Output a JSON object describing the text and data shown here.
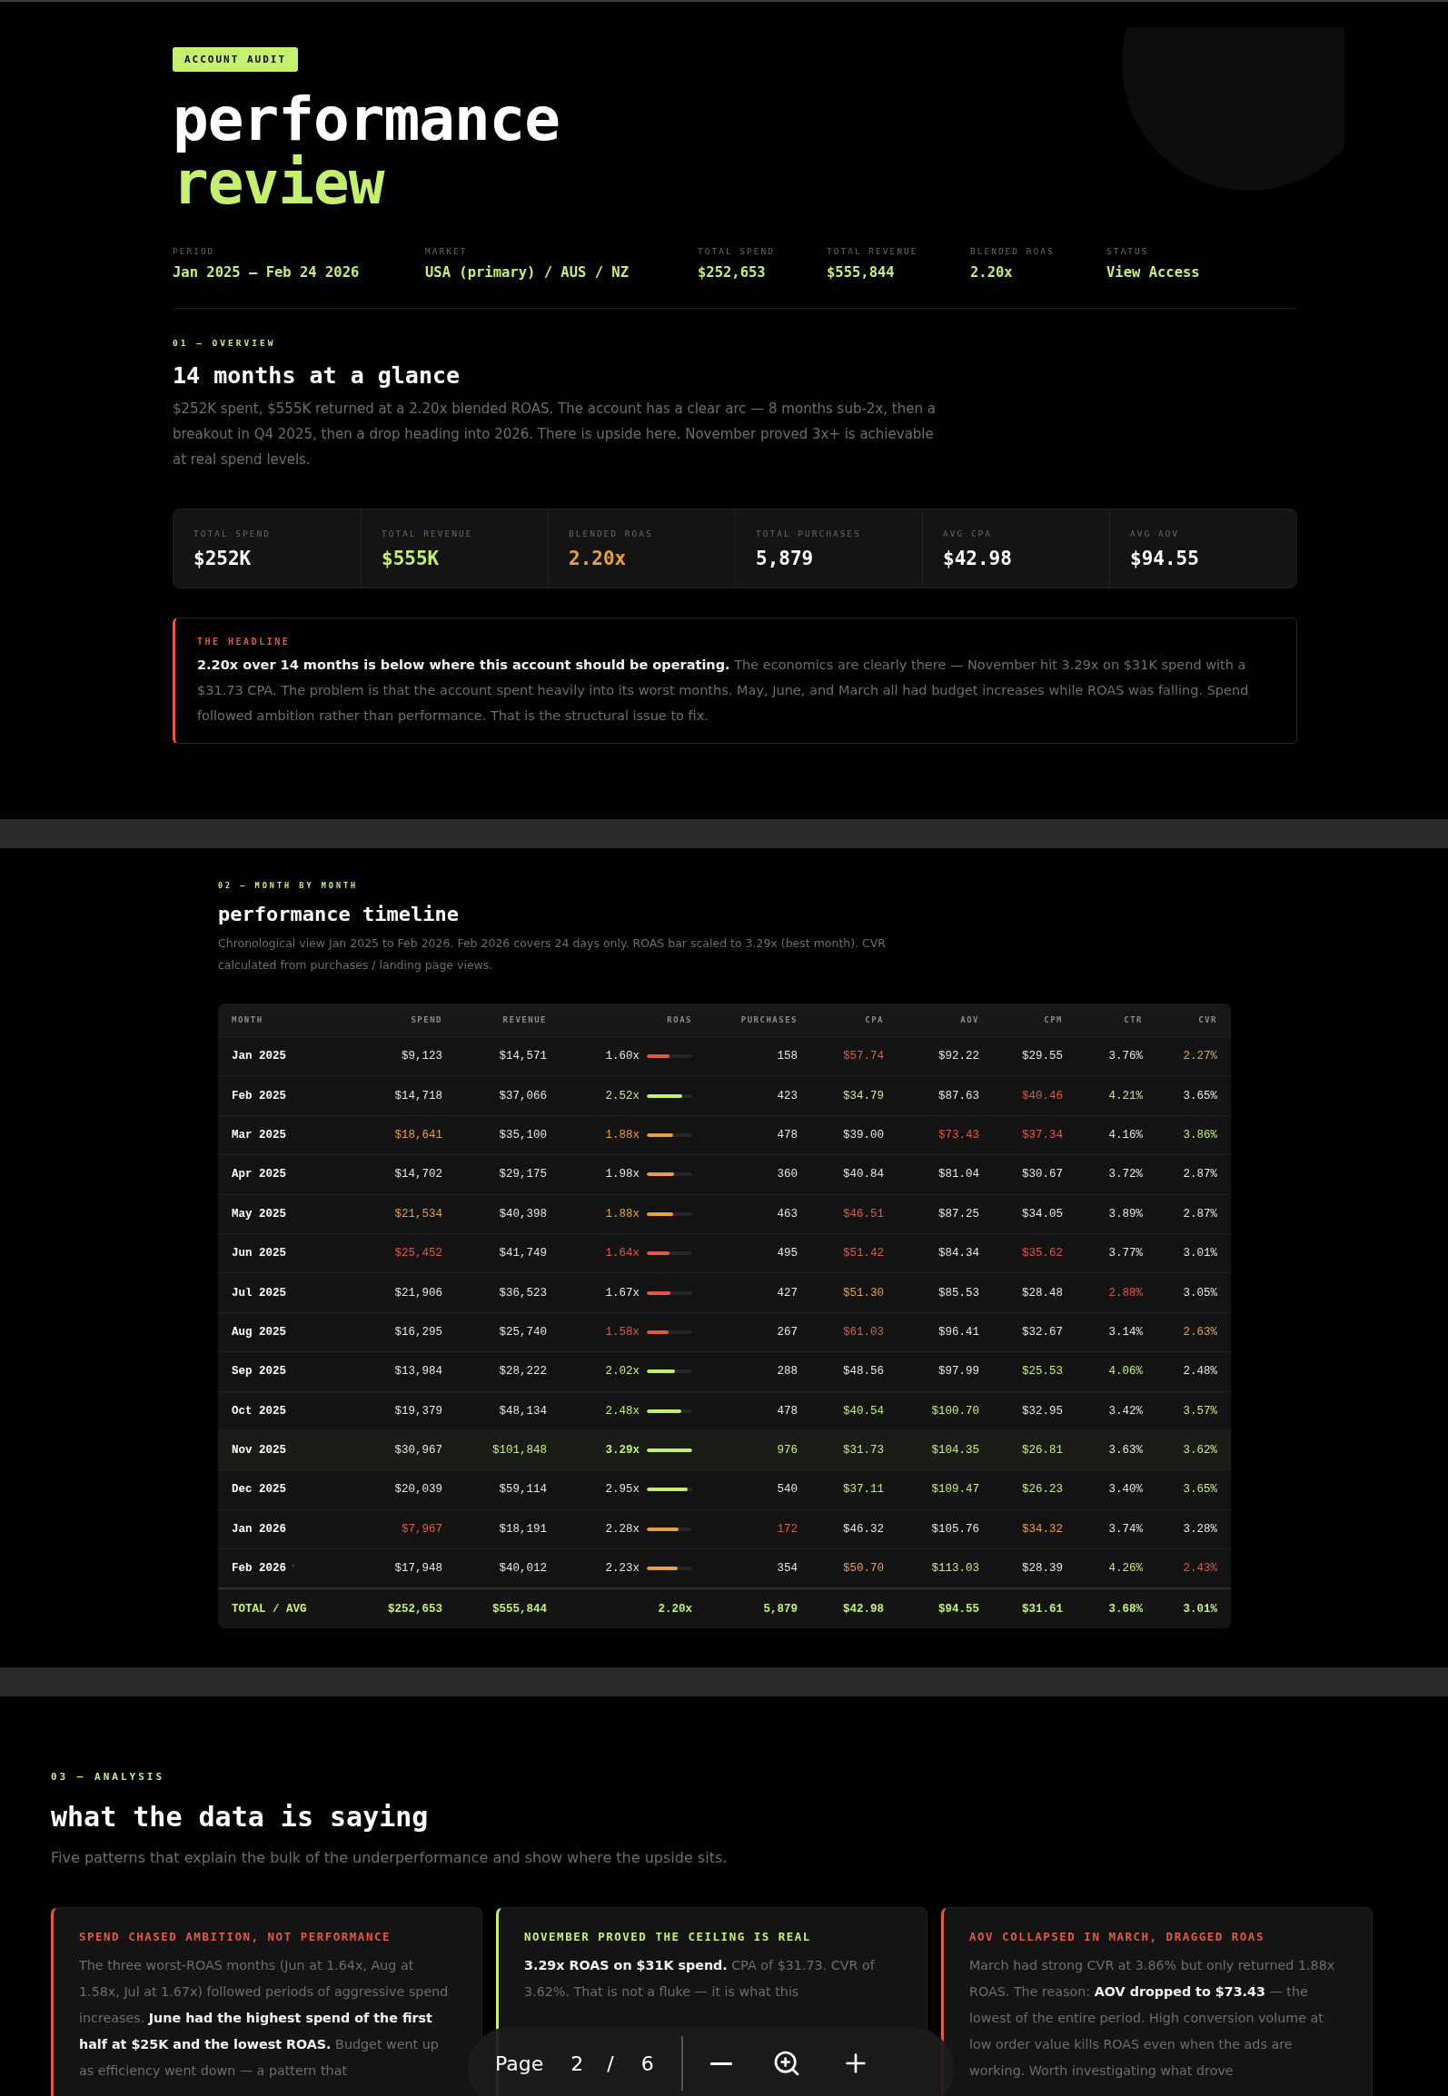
{
  "report": {
    "badge": "ACCOUNT AUDIT",
    "title_line_1": "performance",
    "title_line_2": "review",
    "meta": [
      {
        "label": "PERIOD",
        "value": "Jan 2025 — Feb 24 2026"
      },
      {
        "label": "MARKET",
        "value": "USA (primary) / AUS / NZ"
      },
      {
        "label": "TOTAL SPEND",
        "value": "$252,653"
      },
      {
        "label": "TOTAL REVENUE",
        "value": "$555,844"
      },
      {
        "label": "BLENDED ROAS",
        "value": "2.20x"
      },
      {
        "label": "STATUS",
        "value": "View Access"
      }
    ]
  },
  "overview": {
    "section_label": "01 — OVERVIEW",
    "heading": "14 months at a glance",
    "intro": "$252K spent, $555K returned at a 2.20x blended ROAS. The account has a clear arc — 8 months sub-2x, then a breakout in Q4 2025, then a drop heading into 2026. There is upside here. November proved 3x+ is achievable at real spend levels.",
    "stats": [
      {
        "label": "TOTAL SPEND",
        "value": "$252K",
        "color": "#ffffff"
      },
      {
        "label": "TOTAL REVENUE",
        "value": "$555K",
        "color": "#c5f06f"
      },
      {
        "label": "BLENDED ROAS",
        "value": "2.20x",
        "color": "#e8a043"
      },
      {
        "label": "TOTAL PURCHASES",
        "value": "5,879",
        "color": "#ffffff"
      },
      {
        "label": "AVG CPA",
        "value": "$42.98",
        "color": "#ffffff"
      },
      {
        "label": "AVG AOV",
        "value": "$94.55",
        "color": "#ffffff"
      }
    ],
    "headline": {
      "label": "THE HEADLINE",
      "text": "**2.20x over 14 months is below where this account should be operating.** The economics are clearly there — November hit 3.29x on $31K spend with a $31.73 CPA. The problem is that the account spent heavily into its worst months. May, June, and March all had budget increases while ROAS was falling. Spend followed ambition rather than performance. That is the structural issue to fix."
    }
  },
  "timeline": {
    "section_label": "02 — MONTH BY MONTH",
    "heading": "performance timeline",
    "intro": "Chronological view Jan 2025 to Feb 2026. Feb 2026 covers 24 days only. ROAS bar scaled to 3.29x (best month). CVR calculated from purchases / landing page views.",
    "columns": [
      "MONTH",
      "SPEND",
      "REVENUE",
      "ROAS",
      "PURCHASES",
      "CPA",
      "AOV",
      "CPM",
      "CTR",
      "CVR"
    ],
    "rows": [
      {
        "highlighted": false,
        "cells": [
          {
            "kind": "month",
            "text": "Jan 2025"
          },
          {
            "kind": "text",
            "text": "$9,123",
            "color": "#e6e6e6"
          },
          {
            "kind": "text",
            "text": "$14,571",
            "color": "#e6e6e6"
          },
          {
            "kind": "bar",
            "text": "1.60x",
            "color": "#e6e6e6",
            "bar": {
              "color": "#e05a47",
              "level": 0.49
            }
          },
          {
            "kind": "text",
            "text": "158",
            "color": "#e6e6e6"
          },
          {
            "kind": "text",
            "text": "$57.74",
            "color": "#e05a47"
          },
          {
            "kind": "text",
            "text": "$92.22",
            "color": "#e6e6e6"
          },
          {
            "kind": "text",
            "text": "$29.55",
            "color": "#e6e6e6"
          },
          {
            "kind": "text",
            "text": "3.76%",
            "color": "#e6e6e6"
          },
          {
            "kind": "text",
            "text": "2.27%",
            "color": "#e8a043"
          }
        ]
      },
      {
        "highlighted": false,
        "cells": [
          {
            "kind": "month",
            "text": "Feb 2025"
          },
          {
            "kind": "text",
            "text": "$14,718",
            "color": "#e6e6e6"
          },
          {
            "kind": "text",
            "text": "$37,066",
            "color": "#e6e6e6"
          },
          {
            "kind": "bar",
            "text": "2.52x",
            "color": "#c5f06f",
            "bar": {
              "color": "#c5f06f",
              "level": 0.77
            }
          },
          {
            "kind": "text",
            "text": "423",
            "color": "#e6e6e6"
          },
          {
            "kind": "text",
            "text": "$34.79",
            "color": "#c5f06f"
          },
          {
            "kind": "text",
            "text": "$87.63",
            "color": "#e6e6e6"
          },
          {
            "kind": "text",
            "text": "$40.46",
            "color": "#e05a47"
          },
          {
            "kind": "text",
            "text": "4.21%",
            "color": "#c5f06f"
          },
          {
            "kind": "text",
            "text": "3.65%",
            "color": "#e6e6e6"
          }
        ]
      },
      {
        "highlighted": false,
        "cells": [
          {
            "kind": "month",
            "text": "Mar 2025"
          },
          {
            "kind": "text",
            "text": "$18,641",
            "color": "#e8a043"
          },
          {
            "kind": "text",
            "text": "$35,100",
            "color": "#e6e6e6"
          },
          {
            "kind": "bar",
            "text": "1.88x",
            "color": "#e8a043",
            "bar": {
              "color": "#e8a043",
              "level": 0.57
            }
          },
          {
            "kind": "text",
            "text": "478",
            "color": "#e6e6e6"
          },
          {
            "kind": "text",
            "text": "$39.00",
            "color": "#e6e6e6"
          },
          {
            "kind": "text",
            "text": "$73.43",
            "color": "#e05a47"
          },
          {
            "kind": "text",
            "text": "$37.34",
            "color": "#e05a47"
          },
          {
            "kind": "text",
            "text": "4.16%",
            "color": "#e6e6e6"
          },
          {
            "kind": "text",
            "text": "3.86%",
            "color": "#c5f06f"
          }
        ]
      },
      {
        "highlighted": false,
        "cells": [
          {
            "kind": "month",
            "text": "Apr 2025"
          },
          {
            "kind": "text",
            "text": "$14,702",
            "color": "#e6e6e6"
          },
          {
            "kind": "text",
            "text": "$29,175",
            "color": "#e6e6e6"
          },
          {
            "kind": "bar",
            "text": "1.98x",
            "color": "#e6e6e6",
            "bar": {
              "color": "#e8a043",
              "level": 0.6
            }
          },
          {
            "kind": "text",
            "text": "360",
            "color": "#e6e6e6"
          },
          {
            "kind": "text",
            "text": "$40.84",
            "color": "#e6e6e6"
          },
          {
            "kind": "text",
            "text": "$81.04",
            "color": "#e6e6e6"
          },
          {
            "kind": "text",
            "text": "$30.67",
            "color": "#e6e6e6"
          },
          {
            "kind": "text",
            "text": "3.72%",
            "color": "#e6e6e6"
          },
          {
            "kind": "text",
            "text": "2.87%",
            "color": "#e6e6e6"
          }
        ]
      },
      {
        "highlighted": false,
        "cells": [
          {
            "kind": "month",
            "text": "May 2025"
          },
          {
            "kind": "text",
            "text": "$21,534",
            "color": "#e8a043"
          },
          {
            "kind": "text",
            "text": "$40,398",
            "color": "#e6e6e6"
          },
          {
            "kind": "bar",
            "text": "1.88x",
            "color": "#e8a043",
            "bar": {
              "color": "#e8a043",
              "level": 0.57
            }
          },
          {
            "kind": "text",
            "text": "463",
            "color": "#e6e6e6"
          },
          {
            "kind": "text",
            "text": "$46.51",
            "color": "#e05a47"
          },
          {
            "kind": "text",
            "text": "$87.25",
            "color": "#e6e6e6"
          },
          {
            "kind": "text",
            "text": "$34.05",
            "color": "#e6e6e6"
          },
          {
            "kind": "text",
            "text": "3.89%",
            "color": "#e6e6e6"
          },
          {
            "kind": "text",
            "text": "2.87%",
            "color": "#e6e6e6"
          }
        ]
      },
      {
        "highlighted": false,
        "cells": [
          {
            "kind": "month",
            "text": "Jun 2025"
          },
          {
            "kind": "text",
            "text": "$25,452",
            "color": "#e05a47"
          },
          {
            "kind": "text",
            "text": "$41,749",
            "color": "#e6e6e6"
          },
          {
            "kind": "bar",
            "text": "1.64x",
            "color": "#e05a47",
            "bar": {
              "color": "#e05a47",
              "level": 0.5
            }
          },
          {
            "kind": "text",
            "text": "495",
            "color": "#e6e6e6"
          },
          {
            "kind": "text",
            "text": "$51.42",
            "color": "#e05a47"
          },
          {
            "kind": "text",
            "text": "$84.34",
            "color": "#e6e6e6"
          },
          {
            "kind": "text",
            "text": "$35.62",
            "color": "#e05a47"
          },
          {
            "kind": "text",
            "text": "3.77%",
            "color": "#e6e6e6"
          },
          {
            "kind": "text",
            "text": "3.01%",
            "color": "#e6e6e6"
          }
        ]
      },
      {
        "highlighted": false,
        "cells": [
          {
            "kind": "month",
            "text": "Jul 2025"
          },
          {
            "kind": "text",
            "text": "$21,906",
            "color": "#e6e6e6"
          },
          {
            "kind": "text",
            "text": "$36,523",
            "color": "#e6e6e6"
          },
          {
            "kind": "bar",
            "text": "1.67x",
            "color": "#e6e6e6",
            "bar": {
              "color": "#e05a47",
              "level": 0.51
            }
          },
          {
            "kind": "text",
            "text": "427",
            "color": "#e6e6e6"
          },
          {
            "kind": "text",
            "text": "$51.30",
            "color": "#e8a043"
          },
          {
            "kind": "text",
            "text": "$85.53",
            "color": "#e6e6e6"
          },
          {
            "kind": "text",
            "text": "$28.48",
            "color": "#e6e6e6"
          },
          {
            "kind": "text",
            "text": "2.88%",
            "color": "#e05a47"
          },
          {
            "kind": "text",
            "text": "3.05%",
            "color": "#e6e6e6"
          }
        ]
      },
      {
        "highlighted": false,
        "cells": [
          {
            "kind": "month",
            "text": "Aug 2025"
          },
          {
            "kind": "text",
            "text": "$16,295",
            "color": "#e6e6e6"
          },
          {
            "kind": "text",
            "text": "$25,740",
            "color": "#e6e6e6"
          },
          {
            "kind": "bar",
            "text": "1.58x",
            "color": "#e05a47",
            "bar": {
              "color": "#e05a47",
              "level": 0.48
            }
          },
          {
            "kind": "text",
            "text": "267",
            "color": "#e6e6e6"
          },
          {
            "kind": "text",
            "text": "$61.03",
            "color": "#e05a47"
          },
          {
            "kind": "text",
            "text": "$96.41",
            "color": "#e6e6e6"
          },
          {
            "kind": "text",
            "text": "$32.67",
            "color": "#e6e6e6"
          },
          {
            "kind": "text",
            "text": "3.14%",
            "color": "#e6e6e6"
          },
          {
            "kind": "text",
            "text": "2.63%",
            "color": "#e8a043"
          }
        ]
      },
      {
        "highlighted": false,
        "cells": [
          {
            "kind": "month",
            "text": "Sep 2025"
          },
          {
            "kind": "text",
            "text": "$13,984",
            "color": "#e6e6e6"
          },
          {
            "kind": "text",
            "text": "$28,222",
            "color": "#e6e6e6"
          },
          {
            "kind": "bar",
            "text": "2.02x",
            "color": "#c5f06f",
            "bar": {
              "color": "#c5f06f",
              "level": 0.61
            }
          },
          {
            "kind": "text",
            "text": "288",
            "color": "#e6e6e6"
          },
          {
            "kind": "text",
            "text": "$48.56",
            "color": "#e6e6e6"
          },
          {
            "kind": "text",
            "text": "$97.99",
            "color": "#e6e6e6"
          },
          {
            "kind": "text",
            "text": "$25.53",
            "color": "#c5f06f"
          },
          {
            "kind": "text",
            "text": "4.06%",
            "color": "#c5f06f"
          },
          {
            "kind": "text",
            "text": "2.48%",
            "color": "#e6e6e6"
          }
        ]
      },
      {
        "highlighted": false,
        "cells": [
          {
            "kind": "month",
            "text": "Oct 2025"
          },
          {
            "kind": "text",
            "text": "$19,379",
            "color": "#e6e6e6"
          },
          {
            "kind": "text",
            "text": "$48,134",
            "color": "#e6e6e6"
          },
          {
            "kind": "bar",
            "text": "2.48x",
            "color": "#c5f06f",
            "bar": {
              "color": "#c5f06f",
              "level": 0.75
            }
          },
          {
            "kind": "text",
            "text": "478",
            "color": "#e6e6e6"
          },
          {
            "kind": "text",
            "text": "$40.54",
            "color": "#c5f06f"
          },
          {
            "kind": "text",
            "text": "$100.70",
            "color": "#c5f06f"
          },
          {
            "kind": "text",
            "text": "$32.95",
            "color": "#e6e6e6"
          },
          {
            "kind": "text",
            "text": "3.42%",
            "color": "#e6e6e6"
          },
          {
            "kind": "text",
            "text": "3.57%",
            "color": "#c5f06f"
          }
        ]
      },
      {
        "highlighted": true,
        "cells": [
          {
            "kind": "month",
            "text": "Nov 2025"
          },
          {
            "kind": "text",
            "text": "$30,967",
            "color": "#e6e6e6"
          },
          {
            "kind": "text",
            "text": "$101,848",
            "color": "#c5f06f"
          },
          {
            "kind": "bar",
            "text": "3.29x",
            "color": "#c5f06f",
            "bar": {
              "color": "#c5f06f",
              "level": 1
            }
          },
          {
            "kind": "text",
            "text": "976",
            "color": "#c5f06f"
          },
          {
            "kind": "text",
            "text": "$31.73",
            "color": "#c5f06f"
          },
          {
            "kind": "text",
            "text": "$104.35",
            "color": "#c5f06f"
          },
          {
            "kind": "text",
            "text": "$26.81",
            "color": "#c5f06f"
          },
          {
            "kind": "text",
            "text": "3.63%",
            "color": "#e6e6e6"
          },
          {
            "kind": "text",
            "text": "3.62%",
            "color": "#c5f06f"
          }
        ]
      },
      {
        "highlighted": false,
        "cells": [
          {
            "kind": "month",
            "text": "Dec 2025"
          },
          {
            "kind": "text",
            "text": "$20,039",
            "color": "#e6e6e6"
          },
          {
            "kind": "text",
            "text": "$59,114",
            "color": "#e6e6e6"
          },
          {
            "kind": "bar",
            "text": "2.95x",
            "color": "#e6e6e6",
            "bar": {
              "color": "#c5f06f",
              "level": 0.9
            }
          },
          {
            "kind": "text",
            "text": "540",
            "color": "#e6e6e6"
          },
          {
            "kind": "text",
            "text": "$37.11",
            "color": "#c5f06f"
          },
          {
            "kind": "text",
            "text": "$109.47",
            "color": "#c5f06f"
          },
          {
            "kind": "text",
            "text": "$26.23",
            "color": "#c5f06f"
          },
          {
            "kind": "text",
            "text": "3.40%",
            "color": "#e6e6e6"
          },
          {
            "kind": "text",
            "text": "3.65%",
            "color": "#c5f06f"
          }
        ]
      },
      {
        "highlighted": false,
        "cells": [
          {
            "kind": "month",
            "text": "Jan 2026"
          },
          {
            "kind": "text",
            "text": "$7,967",
            "color": "#e05a47"
          },
          {
            "kind": "text",
            "text": "$18,191",
            "color": "#e6e6e6"
          },
          {
            "kind": "bar",
            "text": "2.28x",
            "color": "#e6e6e6",
            "bar": {
              "color": "#e8a043",
              "level": 0.69
            }
          },
          {
            "kind": "text",
            "text": "172",
            "color": "#e05a47"
          },
          {
            "kind": "text",
            "text": "$46.32",
            "color": "#e6e6e6"
          },
          {
            "kind": "text",
            "text": "$105.76",
            "color": "#e6e6e6"
          },
          {
            "kind": "text",
            "text": "$34.32",
            "color": "#e8a043"
          },
          {
            "kind": "text",
            "text": "3.74%",
            "color": "#e6e6e6"
          },
          {
            "kind": "text",
            "text": "3.28%",
            "color": "#e6e6e6"
          }
        ]
      },
      {
        "highlighted": false,
        "cells": [
          {
            "kind": "month",
            "text": "Feb 2026",
            "note": "*"
          },
          {
            "kind": "text",
            "text": "$17,948",
            "color": "#e6e6e6"
          },
          {
            "kind": "text",
            "text": "$40,012",
            "color": "#e6e6e6"
          },
          {
            "kind": "bar",
            "text": "2.23x",
            "color": "#e6e6e6",
            "bar": {
              "color": "#e8a043",
              "level": 0.68
            }
          },
          {
            "kind": "text",
            "text": "354",
            "color": "#e6e6e6"
          },
          {
            "kind": "text",
            "text": "$50.70",
            "color": "#e8a043"
          },
          {
            "kind": "text",
            "text": "$113.03",
            "color": "#c5f06f"
          },
          {
            "kind": "text",
            "text": "$28.39",
            "color": "#e6e6e6"
          },
          {
            "kind": "text",
            "text": "4.26%",
            "color": "#c5f06f"
          },
          {
            "kind": "text",
            "text": "2.43%",
            "color": "#e05a47"
          }
        ]
      }
    ],
    "total": {
      "label": "TOTAL / AVG",
      "cells": [
        "$252,653",
        "$555,844",
        "2.20x",
        "5,879",
        "$42.98",
        "$94.55",
        "$31.61",
        "3.68%",
        "3.01%"
      ]
    }
  },
  "analysis": {
    "section_label": "03 — ANALYSIS",
    "heading": "what the data is saying",
    "intro": "Five patterns that explain the bulk of the underperformance and show where the upside sits.",
    "cards": [
      {
        "title": "SPEND CHASED AMBITION, NOT PERFORMANCE",
        "color": "#e05a47",
        "text": "The three worst-ROAS months (Jun at 1.64x, Aug at 1.58x, Jul at 1.67x) followed periods of aggressive spend increases. **June had the highest spend of the first half at $25K and the lowest ROAS.** Budget went up as efficiency went down — a pattern that"
      },
      {
        "title": "NOVEMBER PROVED THE CEILING IS REAL",
        "color": "#c5f06f",
        "text": "**3.29x ROAS on $31K spend.** CPA of $31.73. CVR of 3.62%. That is not a fluke — it is what this"
      },
      {
        "title": "AOV COLLAPSED IN MARCH, DRAGGED ROAS",
        "color": "#e05a47",
        "text": "March had strong CVR at 3.86% but only returned 1.88x ROAS. The reason: **AOV dropped to $73.43** — the lowest of the entire period. High conversion volume at low order value kills ROAS even when the ads are working. Worth investigating what drove"
      }
    ]
  },
  "viewer": {
    "page_label": "Page",
    "page": "2",
    "separator": "/",
    "pages": "6"
  }
}
